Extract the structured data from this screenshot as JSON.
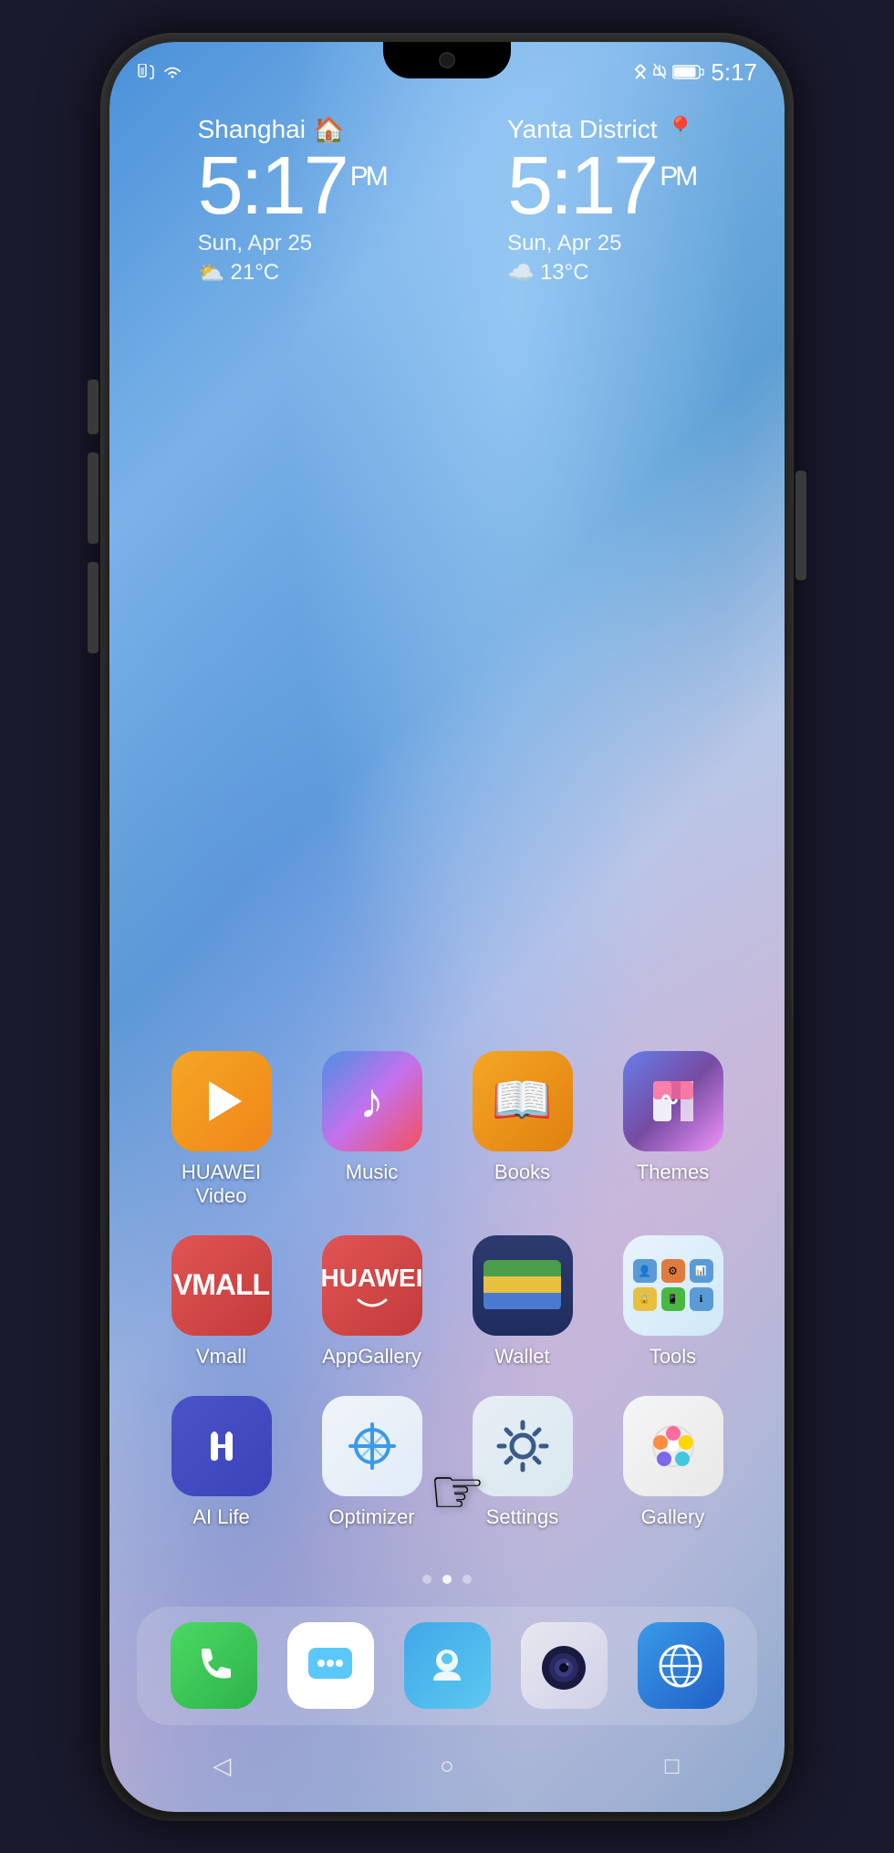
{
  "phone": {
    "status_bar": {
      "left_icons": [
        "sim-icon",
        "wifi-icon"
      ],
      "time": "5:17",
      "right_icons": [
        "bluetooth-icon",
        "silent-icon",
        "battery-icon"
      ]
    }
  },
  "clock_widgets": [
    {
      "city": "Shanghai",
      "city_icon": "🏠",
      "time": "5:17",
      "ampm": "PM",
      "date": "Sun, Apr 25",
      "weather_icon": "⛅",
      "temperature": "21°C"
    },
    {
      "city": "Yanta District",
      "city_icon": "📍",
      "time": "5:17",
      "ampm": "PM",
      "date": "Sun, Apr 25",
      "weather_icon": "☁",
      "temperature": "13°C"
    }
  ],
  "app_rows": [
    [
      {
        "id": "huawei-video",
        "label": "HUAWEI Video",
        "icon_type": "huawei-video"
      },
      {
        "id": "music",
        "label": "Music",
        "icon_type": "music"
      },
      {
        "id": "books",
        "label": "Books",
        "icon_type": "books"
      },
      {
        "id": "themes",
        "label": "Themes",
        "icon_type": "themes"
      }
    ],
    [
      {
        "id": "vmall",
        "label": "Vmall",
        "icon_type": "vmall"
      },
      {
        "id": "appgallery",
        "label": "AppGallery",
        "icon_type": "appgallery"
      },
      {
        "id": "wallet",
        "label": "Wallet",
        "icon_type": "wallet"
      },
      {
        "id": "tools",
        "label": "Tools",
        "icon_type": "tools"
      }
    ],
    [
      {
        "id": "ailife",
        "label": "AI Life",
        "icon_type": "ailife"
      },
      {
        "id": "optimizer",
        "label": "Optimizer",
        "icon_type": "optimizer"
      },
      {
        "id": "settings",
        "label": "Settings",
        "icon_type": "settings"
      },
      {
        "id": "gallery",
        "label": "Gallery",
        "icon_type": "gallery"
      }
    ]
  ],
  "dock_apps": [
    {
      "id": "phone",
      "icon_type": "phone"
    },
    {
      "id": "messages",
      "icon_type": "messages"
    },
    {
      "id": "service",
      "icon_type": "service"
    },
    {
      "id": "camera",
      "icon_type": "camera"
    },
    {
      "id": "browser",
      "icon_type": "browser"
    }
  ],
  "page_dots": [
    {
      "active": false
    },
    {
      "active": true
    },
    {
      "active": false
    }
  ],
  "nav": {
    "back": "◁",
    "home": "○",
    "recent": "□"
  }
}
